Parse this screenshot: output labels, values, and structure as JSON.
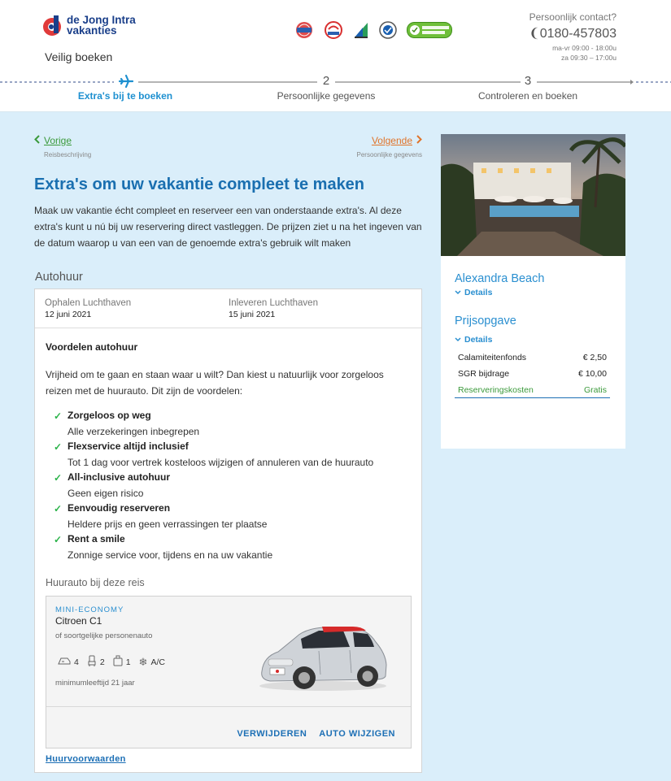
{
  "header": {
    "logo_line1": "de Jong Intra",
    "logo_line2": "vakanties",
    "tagline": "Veilig boeken",
    "badges": [
      "ANVR",
      "SGR",
      "Calamiteitenfonds",
      "Thuiswinkel",
      "COMODO SECURE"
    ],
    "contact": {
      "label": "Persoonlijk contact?",
      "phone": "0180-457803",
      "hours_weekday": "ma-vr 09:00 - 18:00u",
      "hours_saturday": "za 09:30 – 17:00u"
    }
  },
  "stepper": {
    "steps": [
      {
        "number": "",
        "label": "Extra's bij te boeken",
        "active": true
      },
      {
        "number": "2",
        "label": "Persoonlijke gegevens",
        "active": false
      },
      {
        "number": "3",
        "label": "Controleren en boeken",
        "active": false
      }
    ]
  },
  "nav": {
    "prev_label": "Vorige",
    "prev_sub": "Reisbeschrijving",
    "next_label": "Volgende",
    "next_sub": "Persoonlijke gegevens"
  },
  "main": {
    "title": "Extra's om uw vakantie compleet te maken",
    "intro": "Maak uw vakantie écht compleet en reserveer een van onderstaande extra's. Al deze extra's kunt u nú bij uw reservering direct vastleggen. De prijzen ziet u na het ingeven van de datum waarop u van een van de genoemde extra's gebruik wilt maken",
    "section_title": "Autohuur",
    "pickup_label": "Ophalen Luchthaven",
    "pickup_date": "12 juni 2021",
    "return_label": "Inleveren Luchthaven",
    "return_date": "15 juni 2021",
    "benefits_title": "Voordelen autohuur",
    "benefits_intro": "Vrijheid om te gaan en staan waar u wilt? Dan kiest u natuurlijk voor zorgeloos reizen met de huurauto. Dit zijn de voordelen:",
    "benefits": [
      {
        "title": "Zorgeloos op weg",
        "desc": "Alle verzekeringen inbegrepen"
      },
      {
        "title": "Flexservice altijd inclusief",
        "desc": "Tot 1 dag voor vertrek kosteloos wijzigen of annuleren van de huurauto"
      },
      {
        "title": "All-inclusive autohuur",
        "desc": "Geen eigen risico"
      },
      {
        "title": "Eenvoudig reserveren",
        "desc": "Heldere prijs en geen verrassingen ter plaatse"
      },
      {
        "title": "Rent a smile",
        "desc": "Zonnige service voor, tijdens en na uw vakantie"
      }
    ],
    "car_section_title": "Huurauto bij deze reis",
    "car": {
      "category": "MINI-ECONOMY",
      "name": "Citroen C1",
      "similar": "of soortgelijke personenauto",
      "doors": "4",
      "seats": "2",
      "luggage": "1",
      "ac": "A/C",
      "min_age": "minimumleeftijd 21 jaar",
      "remove_label": "VERWIJDEREN",
      "change_label": "AUTO WIJZIGEN"
    },
    "terms_label": "Huurvoorwaarden"
  },
  "sidebar": {
    "hotel_name": "Alexandra Beach",
    "details_label": "Details",
    "price_title": "Prijsopgave",
    "price_details_label": "Details",
    "prices": [
      {
        "label": "Calamiteitenfonds",
        "value": "€ 2,50"
      },
      {
        "label": "SGR bijdrage",
        "value": "€ 10,00"
      },
      {
        "label": "Reserveringskosten",
        "value": "Gratis"
      }
    ]
  },
  "colors": {
    "accent_blue": "#2a8fd0",
    "title_blue": "#1a6fb0",
    "green": "#3b9a3b",
    "orange": "#e0742a",
    "background": "#daeefa"
  }
}
